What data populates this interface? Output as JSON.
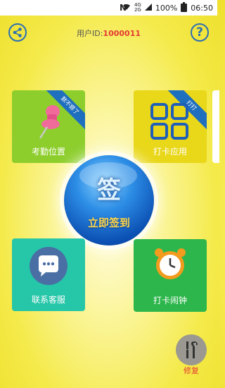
{
  "status_bar": {
    "nfc": "N",
    "network_top": "4G",
    "network_bottom": "2G",
    "battery": "100%",
    "time": "06:50"
  },
  "header": {
    "user_label": "用户ID:",
    "user_id": "1000011",
    "share_icon": "share-icon",
    "help_icon": "?"
  },
  "tiles": {
    "location": {
      "label": "考勤位置",
      "ribbon": "默不摁了",
      "icon": "pushpin-icon",
      "color": "#8dce2d"
    },
    "apps": {
      "label": "打卡应用",
      "ribbon": "打打",
      "icon": "grid-icon",
      "color": "#e9d719"
    },
    "service": {
      "label": "联系客服",
      "icon": "chat-bubble-icon",
      "color": "#26c6a8"
    },
    "alarm": {
      "label": "打卡闹钟",
      "icon": "alarm-clock-icon",
      "color": "#2cb64b"
    }
  },
  "sign_button": {
    "big": "签",
    "small": "立即签到"
  },
  "repair": {
    "label": "修复",
    "icon": "repair-tools-icon"
  }
}
